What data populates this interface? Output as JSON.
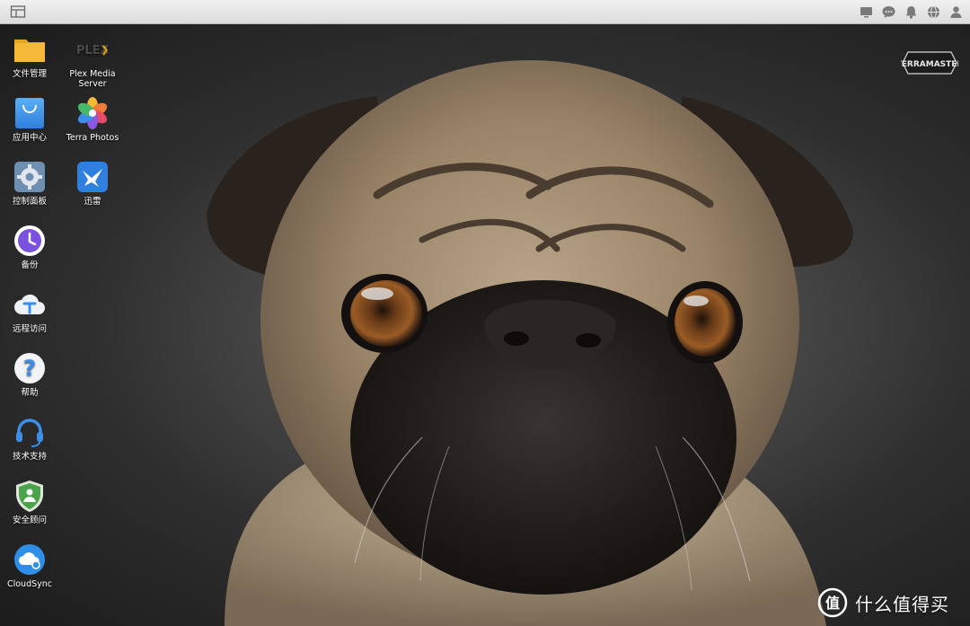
{
  "taskbar": {
    "start_icon": "window-icon",
    "tray_icons": [
      "monitor-icon",
      "chat-icon",
      "bell-icon",
      "globe-icon",
      "user-icon"
    ]
  },
  "desktop": {
    "icons": [
      {
        "name": "file-manager",
        "label": "文件管理",
        "icon": "folder-icon"
      },
      {
        "name": "plex-media-server",
        "label": "Plex Media\nServer",
        "icon": "plex-icon",
        "logo_text": "PLEX"
      },
      {
        "name": "app-center",
        "label": "应用中心",
        "icon": "shopping-bag-icon"
      },
      {
        "name": "terra-photos",
        "label": "Terra Photos",
        "icon": "photos-flower-icon"
      },
      {
        "name": "control-panel",
        "label": "控制面板",
        "icon": "gear-icon"
      },
      {
        "name": "xunlei",
        "label": "迅雷",
        "icon": "bird-icon"
      },
      {
        "name": "backup",
        "label": "备份",
        "icon": "clock-icon"
      },
      {
        "name": "remote-access",
        "label": "远程访问",
        "icon": "cloud-t-icon"
      },
      {
        "name": "help",
        "label": "帮助",
        "icon": "question-icon"
      },
      {
        "name": "tech-support",
        "label": "技术支持",
        "icon": "headset-icon"
      },
      {
        "name": "security-advisor",
        "label": "安全顾问",
        "icon": "shield-icon"
      },
      {
        "name": "cloudsync",
        "label": "CloudSync",
        "icon": "cloud-sync-icon"
      }
    ],
    "brand_logo": "TERRAMASTER",
    "watermark": {
      "symbol": "值",
      "text": "什么值得买"
    }
  },
  "colors": {
    "accent": "#3b8fe8",
    "folder": "#f5b93a",
    "shield": "#4aa34a"
  }
}
